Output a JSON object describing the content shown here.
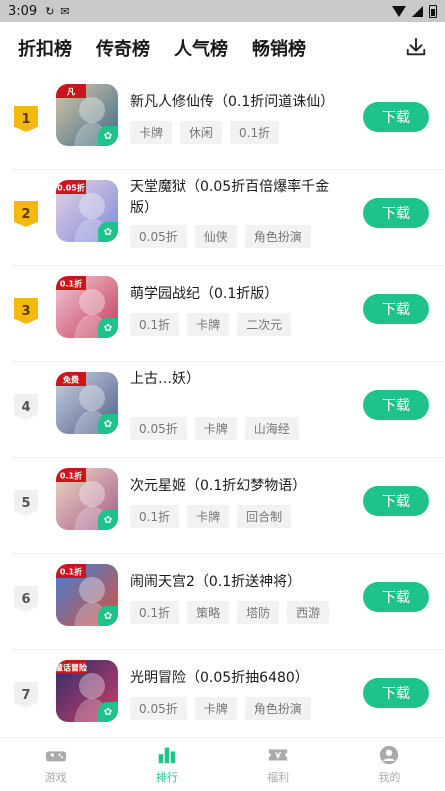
{
  "status": {
    "time": "3:09"
  },
  "tabs": [
    {
      "label": "折扣榜",
      "active": true
    },
    {
      "label": "传奇榜",
      "active": false
    },
    {
      "label": "人气榜",
      "active": false
    },
    {
      "label": "畅销榜",
      "active": false
    }
  ],
  "download_label": "下载",
  "games": [
    {
      "rank": "1",
      "title": "新凡人修仙传（0.1折问道诛仙）",
      "tags": [
        "卡牌",
        "休闲",
        "0.1折"
      ],
      "icon_text": "凡",
      "icon_colors": [
        "#d9c7a6",
        "#3a6b8a"
      ]
    },
    {
      "rank": "2",
      "title": "天堂魔狱（0.05折百倍爆率千金版）",
      "tags": [
        "0.05折",
        "仙侠",
        "角色扮演"
      ],
      "icon_text": "0.05折",
      "icon_colors": [
        "#e8d2e6",
        "#7d8ad6"
      ]
    },
    {
      "rank": "3",
      "title": "萌学园战纪（0.1折版）",
      "tags": [
        "0.1折",
        "卡牌",
        "二次元"
      ],
      "icon_text": "0.1折",
      "icon_colors": [
        "#f4c9d8",
        "#c23a57"
      ]
    },
    {
      "rank": "4",
      "title": "上古…妖）",
      "tags": [
        "0.05折",
        "卡牌",
        "山海经"
      ],
      "icon_text": "免费",
      "icon_colors": [
        "#c9d3e6",
        "#4e5d82"
      ]
    },
    {
      "rank": "5",
      "title": "次元星姬（0.1折幻梦物语）",
      "tags": [
        "0.1折",
        "卡牌",
        "回合制"
      ],
      "icon_text": "0.1折",
      "icon_colors": [
        "#f1d9c4",
        "#a25a8a"
      ]
    },
    {
      "rank": "6",
      "title": "闹闹天宫2（0.1折送神将）",
      "tags": [
        "0.1折",
        "策略",
        "塔防",
        "西游"
      ],
      "icon_text": "0.1折",
      "icon_colors": [
        "#3f7fd6",
        "#d6543f"
      ]
    },
    {
      "rank": "7",
      "title": "光明冒险（0.05折抽6480）",
      "tags": [
        "0.05折",
        "卡牌",
        "角色扮演"
      ],
      "icon_text": "童话冒险",
      "icon_colors": [
        "#2a2f6b",
        "#d23c6a"
      ]
    }
  ],
  "bottom_nav": [
    {
      "label": "游戏",
      "icon": "gamepad-icon",
      "active": false
    },
    {
      "label": "排行",
      "icon": "rank-chart-icon",
      "active": true
    },
    {
      "label": "福利",
      "icon": "ticket-icon",
      "active": false
    },
    {
      "label": "我的",
      "icon": "user-icon",
      "active": false
    }
  ],
  "colors": {
    "accent": "#1ec28b",
    "gold": "#f5b80d"
  }
}
